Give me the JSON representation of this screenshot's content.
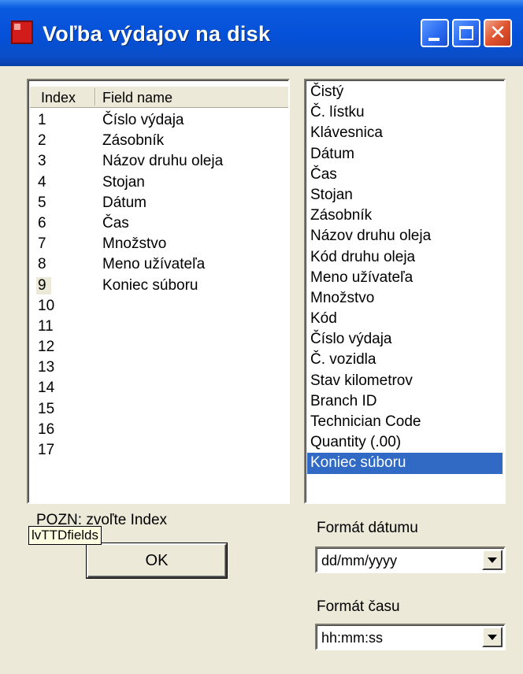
{
  "window": {
    "title": "Voľba výdajov na disk",
    "titlebar_color": "#0550d8"
  },
  "listview": {
    "columns": [
      "Index",
      "Field name"
    ],
    "rows": [
      {
        "index": "1",
        "field": "Číslo výdaja"
      },
      {
        "index": "2",
        "field": "Zásobník"
      },
      {
        "index": "3",
        "field": "Názov druhu oleja"
      },
      {
        "index": "4",
        "field": "Stojan"
      },
      {
        "index": "5",
        "field": "Dátum"
      },
      {
        "index": "6",
        "field": "Čas"
      },
      {
        "index": "7",
        "field": "Množstvo"
      },
      {
        "index": "8",
        "field": "Meno užívateľa"
      },
      {
        "index": "9",
        "field": "Koniec súboru"
      },
      {
        "index": "10",
        "field": ""
      },
      {
        "index": "11",
        "field": ""
      },
      {
        "index": "12",
        "field": ""
      },
      {
        "index": "13",
        "field": ""
      },
      {
        "index": "14",
        "field": ""
      },
      {
        "index": "15",
        "field": ""
      },
      {
        "index": "16",
        "field": ""
      },
      {
        "index": "17",
        "field": ""
      }
    ],
    "selected_index": "9"
  },
  "listbox": {
    "items": [
      "Čistý",
      "Č. lístku",
      "Klávesnica",
      "Dátum",
      "Čas",
      "Stojan",
      "Zásobník",
      "Názov druhu oleja",
      "Kód druhu oleja",
      "Meno užívateľa",
      "Množstvo",
      "Kód",
      "Číslo výdaja",
      "Č. vozidla",
      "Stav kilometrov",
      "Branch ID",
      "Technician Code",
      "Quantity (.00)",
      "Koniec súboru"
    ],
    "selected_item": "Koniec súboru",
    "selection_color": "#316ac5"
  },
  "note": "POZN: zvoľte Index",
  "tooltip": "lvTTDfields",
  "ok_label": "OK",
  "date_format": {
    "label": "Formát dátumu",
    "value": "dd/mm/yyyy"
  },
  "time_format": {
    "label": "Formát času",
    "value": "hh:mm:ss"
  }
}
